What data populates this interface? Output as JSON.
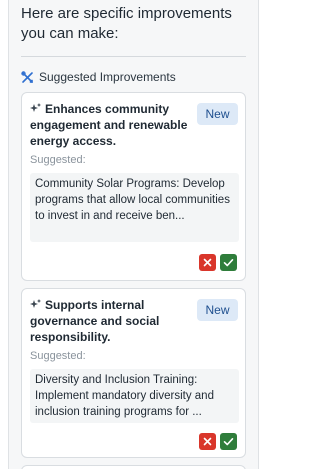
{
  "intro": "Here are specific improvements you can make:",
  "section": {
    "title": "Suggested Improvements",
    "icon": "tools-icon"
  },
  "suggested_label": "Suggested:",
  "cards": [
    {
      "title": "Enhances community engagement and renewable energy access.",
      "badge": "New",
      "suggestion": "Community Solar Programs: Develop programs that allow local communities to invest in and receive ben...",
      "reject_icon": "x-icon",
      "accept_icon": "check-icon"
    },
    {
      "title": "Supports internal governance and social responsibility.",
      "badge": "New",
      "suggestion": "Diversity and Inclusion Training: Implement mandatory diversity and inclusion training programs for ...",
      "reject_icon": "x-icon",
      "accept_icon": "check-icon"
    }
  ],
  "colors": {
    "badge_bg": "#dde9f7",
    "badge_text": "#1e4f8f",
    "reject": "#d9362b",
    "accept": "#2f7d3b",
    "section_icon": "#2f6fd0"
  }
}
